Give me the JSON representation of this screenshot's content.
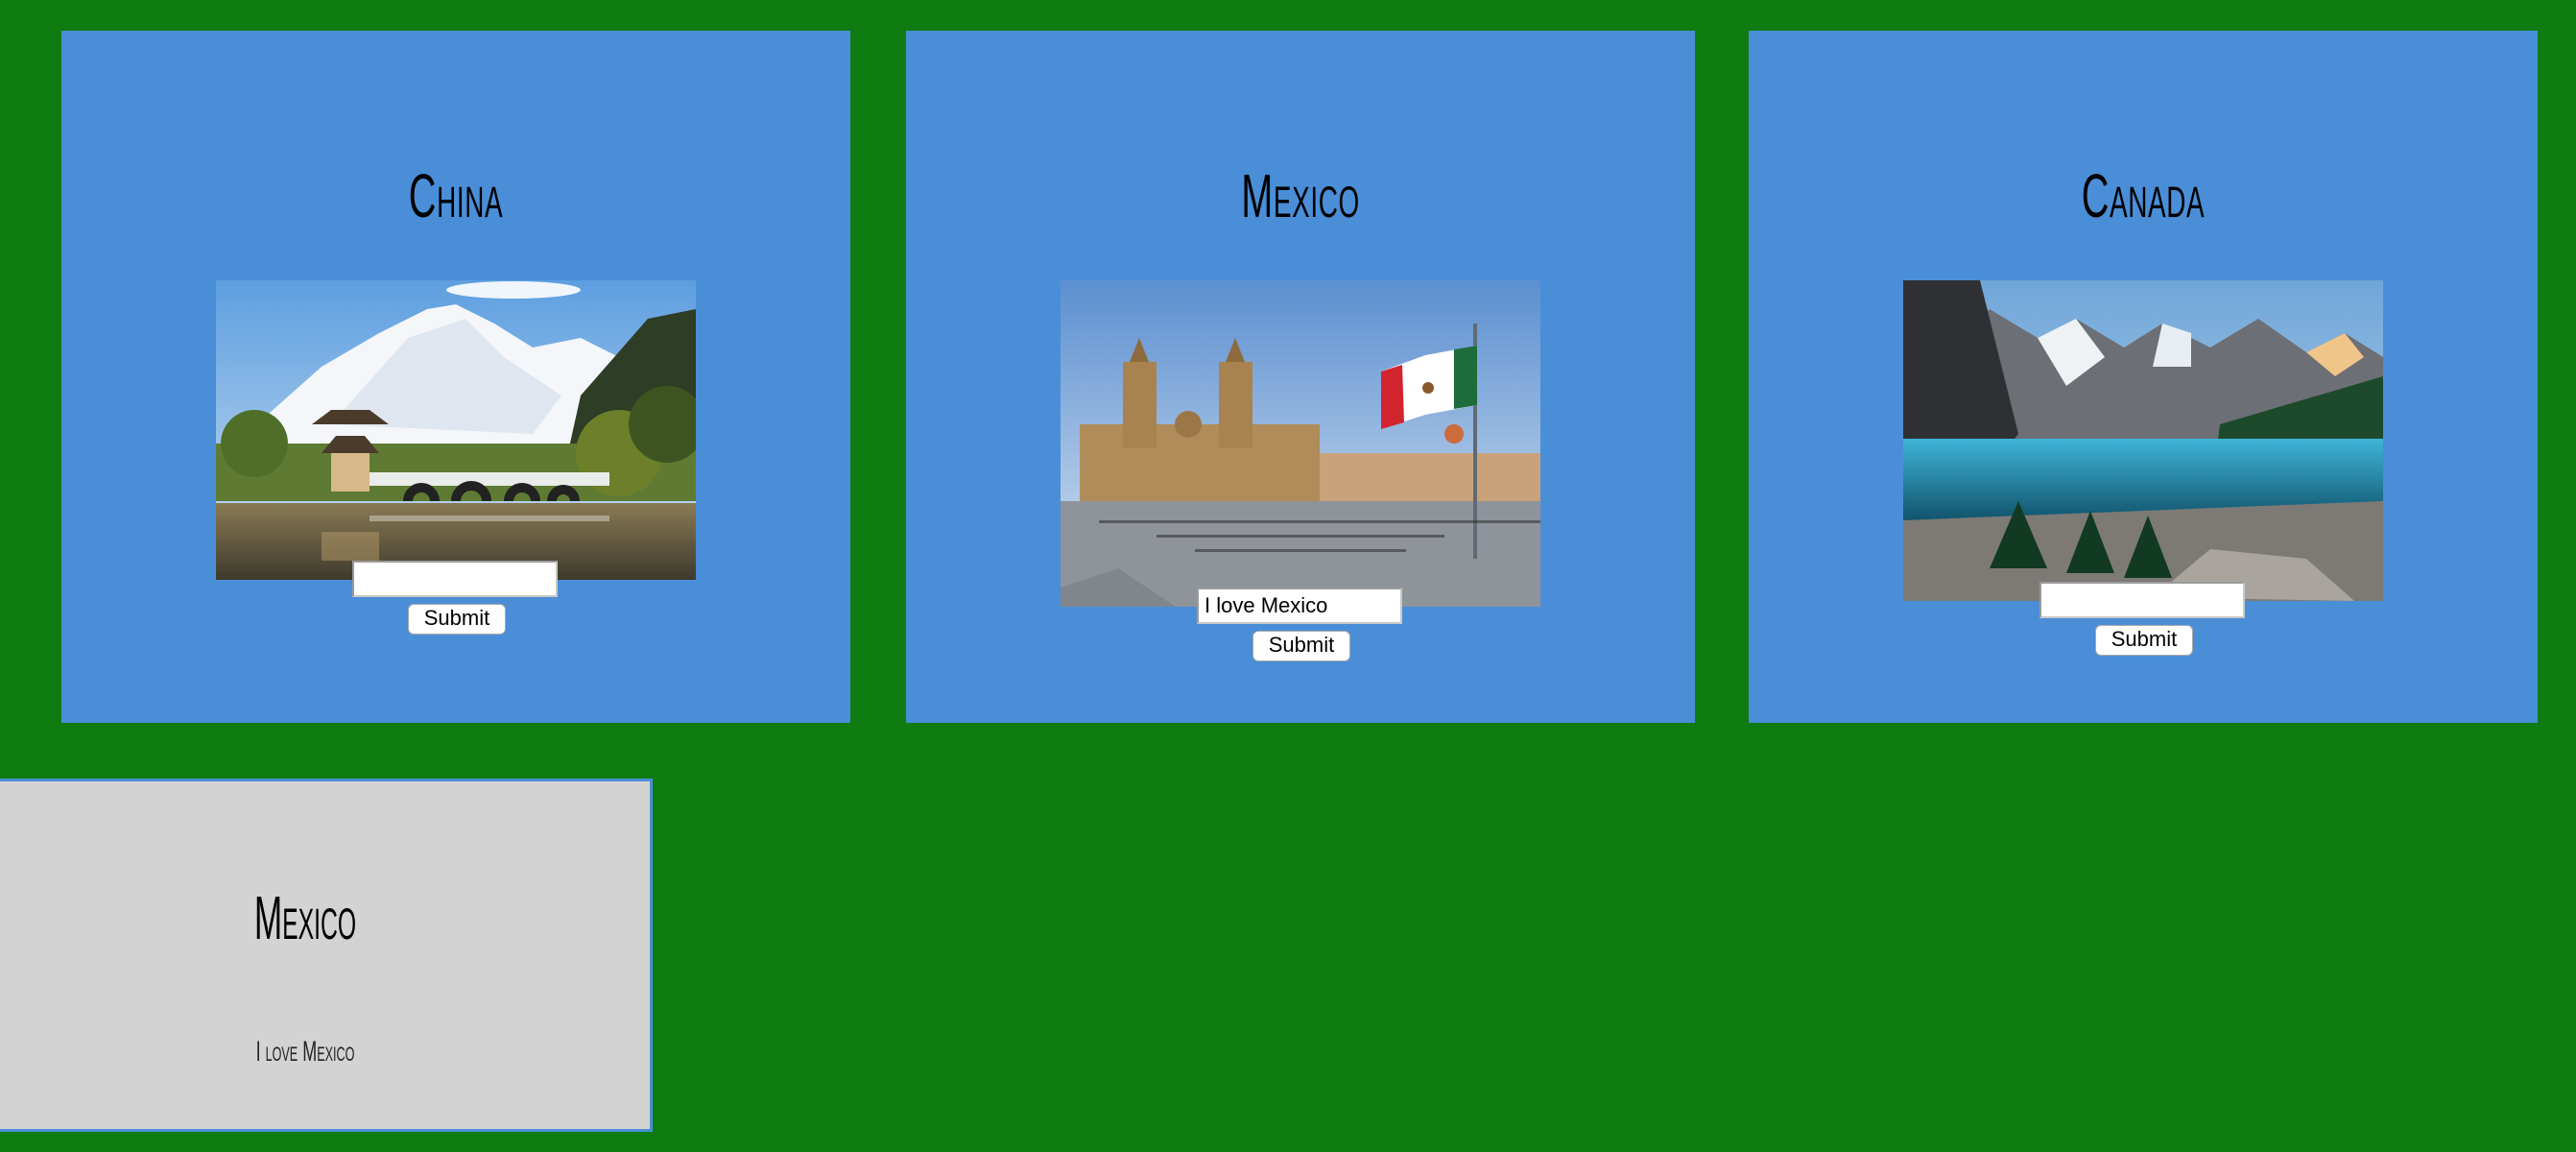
{
  "cards": [
    {
      "title": "China",
      "image_icon": "china-landscape-photo",
      "input_value": "",
      "submit_label": "Submit"
    },
    {
      "title": "Mexico",
      "image_icon": "mexico-city-plaza-photo",
      "input_value": "I love Mexico",
      "submit_label": "Submit"
    },
    {
      "title": "Canada",
      "image_icon": "canada-lake-mountains-photo",
      "input_value": "",
      "submit_label": "Submit"
    }
  ],
  "result": {
    "title": "Mexico",
    "text": "I love Mexico"
  },
  "colors": {
    "background": "#0f7c12",
    "card": "#4a8ed8",
    "result_card": "#d3d3d3"
  }
}
